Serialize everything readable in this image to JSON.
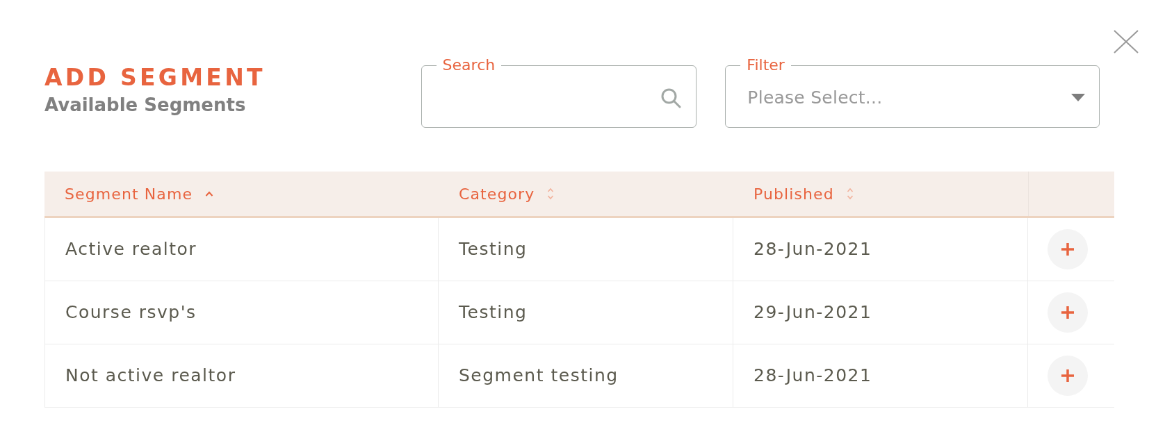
{
  "dialog": {
    "title": "ADD SEGMENT",
    "subtitle": "Available Segments"
  },
  "search": {
    "label": "Search"
  },
  "filter": {
    "label": "Filter",
    "placeholder": "Please Select..."
  },
  "table": {
    "columns": [
      {
        "label": "Segment Name",
        "sorted": true
      },
      {
        "label": "Category",
        "sorted": false
      },
      {
        "label": "Published",
        "sorted": false
      }
    ],
    "rows": [
      {
        "cells": [
          "Active realtor",
          "Testing",
          "28-Jun-2021"
        ]
      },
      {
        "cells": [
          "Course rsvp's",
          "Testing",
          "29-Jun-2021"
        ]
      },
      {
        "cells": [
          "Not active realtor",
          "Segment testing",
          "28-Jun-2021"
        ]
      }
    ]
  }
}
